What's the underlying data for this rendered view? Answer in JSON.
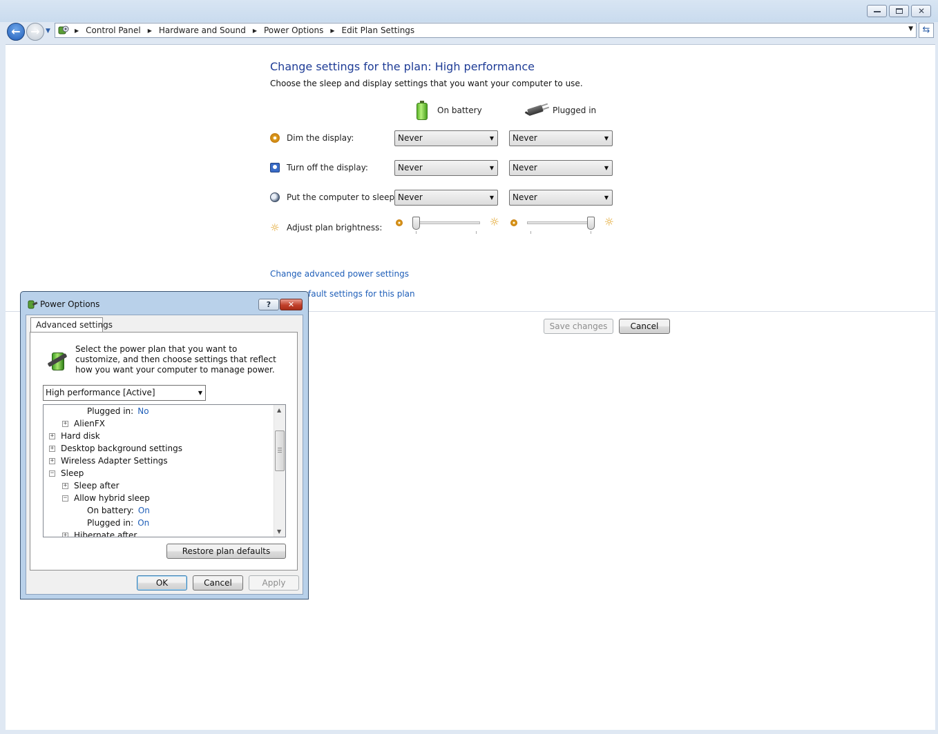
{
  "window": {
    "breadcrumbs": [
      "Control Panel",
      "Hardware and Sound",
      "Power Options",
      "Edit Plan Settings"
    ]
  },
  "page": {
    "title": "Change settings for the plan: High performance",
    "subtitle": "Choose the sleep and display settings that you want your computer to use.",
    "col_battery": "On battery",
    "col_plugged": "Plugged in",
    "rows": {
      "dim": {
        "label": "Dim the display:",
        "battery": "Never",
        "plugged": "Never"
      },
      "turnoff": {
        "label": "Turn off the display:",
        "battery": "Never",
        "plugged": "Never"
      },
      "sleep": {
        "label": "Put the computer to sleep:",
        "battery": "Never",
        "plugged": "Never"
      },
      "brightness": {
        "label": "Adjust plan brightness:",
        "battery_level": 0,
        "plugged_level": 1
      }
    },
    "link_advanced": "Change advanced power settings",
    "link_restore": "Restore default settings for this plan",
    "link_restore_visible": "fault settings for this plan",
    "save_button": "Save changes",
    "cancel_button": "Cancel"
  },
  "dialog": {
    "title": "Power Options",
    "help_glyph": "?",
    "close_glyph": "✕",
    "tab": "Advanced settings",
    "description": "Select the power plan that you want to customize, and then choose settings that reflect how you want your computer to manage power.",
    "plan_selected": "High performance [Active]",
    "tree": {
      "plugged_in_1": {
        "label": "Plugged in:",
        "value": "No"
      },
      "alienfx": "AlienFX",
      "hard_disk": "Hard disk",
      "desktop_bg": "Desktop background settings",
      "wireless": "Wireless Adapter Settings",
      "sleep": "Sleep",
      "sleep_after": "Sleep after",
      "hybrid": "Allow hybrid sleep",
      "on_battery": {
        "label": "On battery:",
        "value": "On"
      },
      "plugged_in_2": {
        "label": "Plugged in:",
        "value": "On"
      },
      "hibernate": "Hibernate after"
    },
    "restore_button": "Restore plan defaults",
    "ok_button": "OK",
    "cancel_button": "Cancel",
    "apply_button": "Apply"
  },
  "colors": {
    "link": "#1e5eb8",
    "title_blue": "#1e3c96",
    "value_blue": "#1e5eb8"
  }
}
